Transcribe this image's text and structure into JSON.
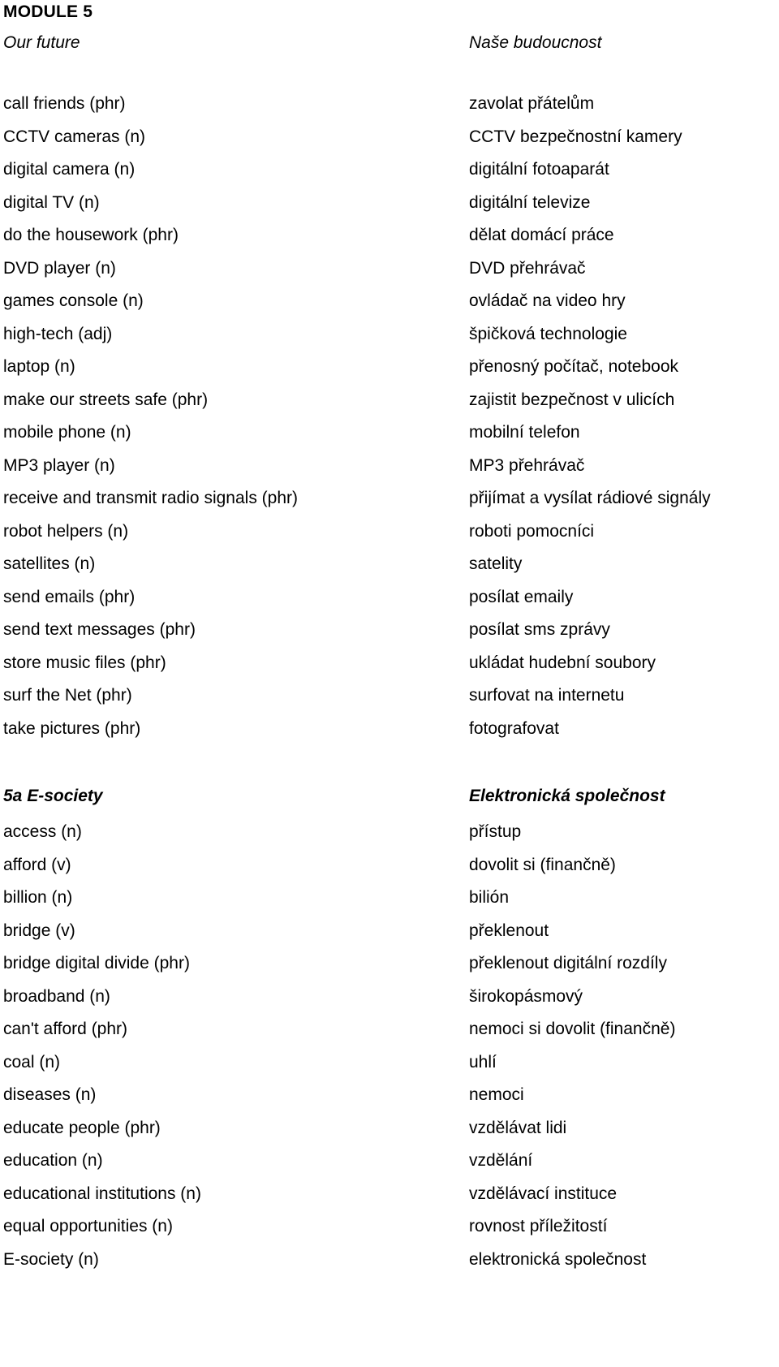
{
  "document": {
    "module_title": "MODULE 5",
    "sections": [
      {
        "id": "our-future",
        "heading_en": "Our future",
        "heading_cs": "Naše budoucnost",
        "heading_style": "italic",
        "entries": [
          {
            "term": "call friends (phr)",
            "translation": "zavolat přátelům"
          },
          {
            "term": "CCTV cameras (n)",
            "translation": "CCTV bezpečnostní kamery"
          },
          {
            "term": "digital camera (n)",
            "translation": "digitální fotoaparát"
          },
          {
            "term": "digital TV (n)",
            "translation": "digitální televize"
          },
          {
            "term": "do the housework (phr)",
            "translation": "dělat domácí práce"
          },
          {
            "term": "DVD player (n)",
            "translation": "DVD přehrávač"
          },
          {
            "term": "games console (n)",
            "translation": "ovládač na video hry"
          },
          {
            "term": "high-tech (adj)",
            "translation": "špičková technologie"
          },
          {
            "term": "laptop (n)",
            "translation": "přenosný počítač, notebook"
          },
          {
            "term": "make our streets safe (phr)",
            "translation": "zajistit bezpečnost v ulicích"
          },
          {
            "term": "mobile phone (n)",
            "translation": "mobilní telefon"
          },
          {
            "term": "MP3 player (n)",
            "translation": "MP3 přehrávač"
          },
          {
            "term": "receive and transmit radio signals (phr)",
            "translation": "přijímat a vysílat rádiové signály"
          },
          {
            "term": "robot helpers (n)",
            "translation": "roboti pomocníci"
          },
          {
            "term": "satellites (n)",
            "translation": "satelity"
          },
          {
            "term": "send emails (phr)",
            "translation": "posílat emaily"
          },
          {
            "term": "send text messages (phr)",
            "translation": "posílat sms zprávy"
          },
          {
            "term": "store music files (phr)",
            "translation": "ukládat hudební soubory"
          },
          {
            "term": "surf the Net (phr)",
            "translation": "surfovat na internetu"
          },
          {
            "term": "take pictures (phr)",
            "translation": "fotografovat"
          }
        ]
      },
      {
        "id": "e-society",
        "heading_en": "5a E-society",
        "heading_cs": "Elektronická společnost",
        "heading_style": "bold-italic",
        "entries": [
          {
            "term": "access (n)",
            "translation": "přístup"
          },
          {
            "term": "afford (v)",
            "translation": "dovolit si (finančně)"
          },
          {
            "term": "billion (n)",
            "translation": "bilión"
          },
          {
            "term": "bridge (v)",
            "translation": "překlenout"
          },
          {
            "term": "bridge digital divide (phr)",
            "translation": "překlenout digitální rozdíly"
          },
          {
            "term": "broadband (n)",
            "translation": "širokopásmový"
          },
          {
            "term": "can't afford (phr)",
            "translation": "nemoci si dovolit (finančně)"
          },
          {
            "term": "coal (n)",
            "translation": "uhlí"
          },
          {
            "term": "diseases (n)",
            "translation": "nemoci"
          },
          {
            "term": "educate people (phr)",
            "translation": "vzdělávat lidi"
          },
          {
            "term": "education (n)",
            "translation": "vzdělání"
          },
          {
            "term": "educational institutions (n)",
            "translation": "vzdělávací instituce"
          },
          {
            "term": "equal opportunities (n)",
            "translation": "rovnost příležitostí"
          },
          {
            "term": "E-society (n)",
            "translation": "elektronická společnost"
          }
        ]
      }
    ]
  }
}
